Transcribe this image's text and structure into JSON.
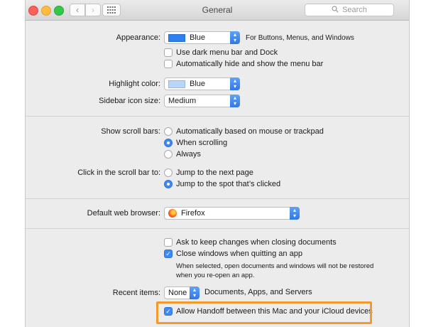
{
  "window": {
    "title": "General"
  },
  "search": {
    "placeholder": "Search"
  },
  "appearance": {
    "label": "Appearance:",
    "value": "Blue",
    "suffix": "For Buttons, Menus, and Windows",
    "swatch_color": "#2f7ff0",
    "dark_menu": "Use dark menu bar and Dock",
    "auto_hide": "Automatically hide and show the menu bar"
  },
  "highlight": {
    "label": "Highlight color:",
    "value": "Blue",
    "swatch_color": "#b8d6fb"
  },
  "sidebar_icon": {
    "label": "Sidebar icon size:",
    "value": "Medium"
  },
  "scroll_bars": {
    "label": "Show scroll bars:",
    "options": [
      "Automatically based on mouse or trackpad",
      "When scrolling",
      "Always"
    ],
    "selected": "When scrolling"
  },
  "click_scroll": {
    "label": "Click in the scroll bar to:",
    "options": [
      "Jump to the next page",
      "Jump to the spot that’s clicked"
    ],
    "selected": "Jump to the spot that’s clicked"
  },
  "browser": {
    "label": "Default web browser:",
    "value": "Firefox"
  },
  "documents": {
    "ask_changes": "Ask to keep changes when closing documents",
    "close_windows": "Close windows when quitting an app",
    "note_line1": "When selected, open documents and windows will not be restored",
    "note_line2": "when you re-open an app."
  },
  "recent": {
    "label": "Recent items:",
    "value": "None",
    "suffix": "Documents, Apps, and Servers"
  },
  "handoff": {
    "label": "Allow Handoff between this Mac and your iCloud devices"
  },
  "colors": {
    "accent": "#3d8af7",
    "highlight_border": "#f29a2e"
  }
}
